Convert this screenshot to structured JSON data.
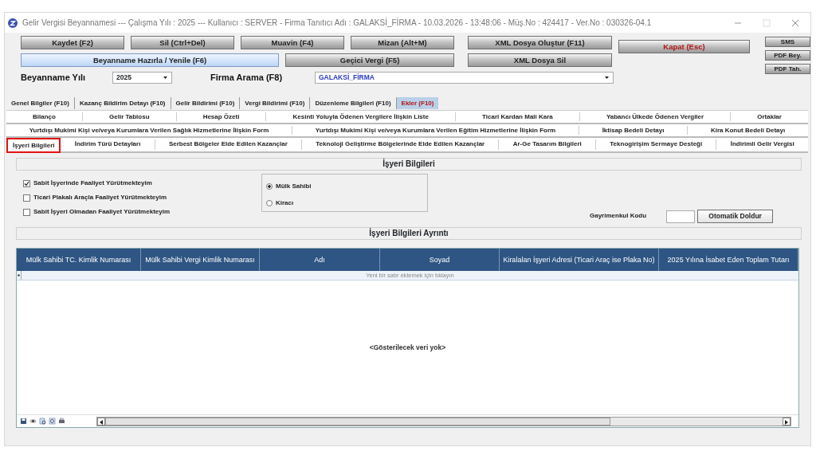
{
  "window": {
    "title": "Gelir Vergisi Beyannamesi  ---  Çalışma Yılı : 2025  ---  Kullanıcı : SERVER - Firma Tanıtıcı Adı : GALAKSİ_FİRMA - 10.03.2026 - 13:48:06 - Müş.No : 424417 - Ver.No : 030326-04.1"
  },
  "toolbar_row_1": [
    {
      "label": "Kaydet (F2)"
    },
    {
      "label": "Sil (Ctrl+Del)"
    },
    {
      "label": "Muavin (F4)"
    },
    {
      "label": "Mizan (Alt+M)"
    }
  ],
  "toolbar_row_2": [
    {
      "label": "Beyanname Hazırla / Yenile (F6)",
      "kind": "primary"
    },
    {
      "label": "Geçici Vergi (F5)"
    }
  ],
  "xml_buttons": [
    {
      "label": "XML Dosya Oluştur (F11)"
    },
    {
      "label": "XML Dosya Sil"
    }
  ],
  "close_button": {
    "label": "Kapat (Esc)",
    "kind": "danger"
  },
  "side_buttons": [
    "SMS",
    "PDF Bey.",
    "PDF Tah."
  ],
  "year": {
    "label": "Beyanname Yılı",
    "value": "2025"
  },
  "company": {
    "label": "Firma Arama (F8)",
    "value": "GALAKSİ_FİRMA"
  },
  "tabs": [
    {
      "label": "Genel Bilgiler (F10)",
      "selected": false
    },
    {
      "label": "Kazanç Bildirim Detayı (F10)",
      "selected": false
    },
    {
      "label": "Gelir Bildirimi (F10)",
      "selected": false
    },
    {
      "label": "Vergi Bildirimi (F10)",
      "selected": false
    },
    {
      "label": "Düzenleme Bilgileri (F10)",
      "selected": false
    },
    {
      "label": "Ekler (F10)",
      "selected": true
    }
  ],
  "subtab_rows": [
    [
      {
        "label": "Bilanço",
        "selected": false
      },
      {
        "label": "Gelir Tablosu",
        "selected": false
      },
      {
        "label": "Hesap Özeti",
        "selected": false
      },
      {
        "label": "Kesinti Yoluyla Ödenen Vergilere İlişkin Liste",
        "selected": false
      },
      {
        "label": "Ticari Kardan Mali Kara",
        "selected": false
      },
      {
        "label": "Yabancı Ülkede Ödenen Vergiler",
        "selected": false
      },
      {
        "label": "Ortaklar",
        "selected": false
      }
    ],
    [
      {
        "label": "Yurtdışı Mukimi Kişi ve/veya Kurumlara Verilen Sağlık Hizmetlerine İlişkin Form",
        "selected": false
      },
      {
        "label": "Yurtdışı Mukimi Kişi ve/veya Kurumlara Verilen Eğitim Hizmetlerine İlişkin Form",
        "selected": false
      },
      {
        "label": "İktisap Bedeli Detayı",
        "selected": false
      },
      {
        "label": "Kira Konut Bedeli Detayı",
        "selected": false
      }
    ],
    [
      {
        "label": "İşyeri Bilgileri",
        "selected": true
      },
      {
        "label": "İndirim Türü Detayları",
        "selected": false
      },
      {
        "label": "Serbest Bölgeler Elde Edilen Kazançlar",
        "selected": false
      },
      {
        "label": "Teknoloji Geliştirme Bölgelerinde Elde Edilen Kazançlar",
        "selected": false
      },
      {
        "label": "Ar-Ge Tasarım Bilgileri",
        "selected": false
      },
      {
        "label": "Teknogirişim Sermaye Desteği",
        "selected": false
      },
      {
        "label": "İndirimli Gelir Vergisi",
        "selected": false
      }
    ]
  ],
  "section_title": "İşyeri Bilgileri",
  "checkboxes": [
    {
      "label": "Sabit İşyerinde Faaliyet Yürütmekteyim",
      "checked": true
    },
    {
      "label": "Ticari Plakalı Araçla Faaliyet Yürütmekteyim",
      "checked": false
    },
    {
      "label": "Sabit İşyeri Olmadan Faaliyet Yürütmekteyim",
      "checked": false
    }
  ],
  "radios": [
    {
      "label": "Mülk Sahibi",
      "selected": true
    },
    {
      "label": "Kiracı",
      "selected": false
    }
  ],
  "property_code": {
    "label": "Gayrimenkul Kodu",
    "button": "Otomatik Doldur"
  },
  "detail_title": "İşyeri Bilgileri Ayrıntı",
  "table": {
    "columns": [
      "Mülk Sahibi TC. Kimlik Numarası",
      "Mülk Sahibi Vergi Kimlik Numarası",
      "Adı",
      "Soyad",
      "Kiralalan İşyeri Adresi (Ticari Araç ise Plaka No)",
      "2025 Yılına İsabet Eden Toplam Tutarı"
    ],
    "new_row_hint": "Yeni bir satır eklemek için tıklayın",
    "empty_text": "<Gösterilecek veri yok>"
  }
}
